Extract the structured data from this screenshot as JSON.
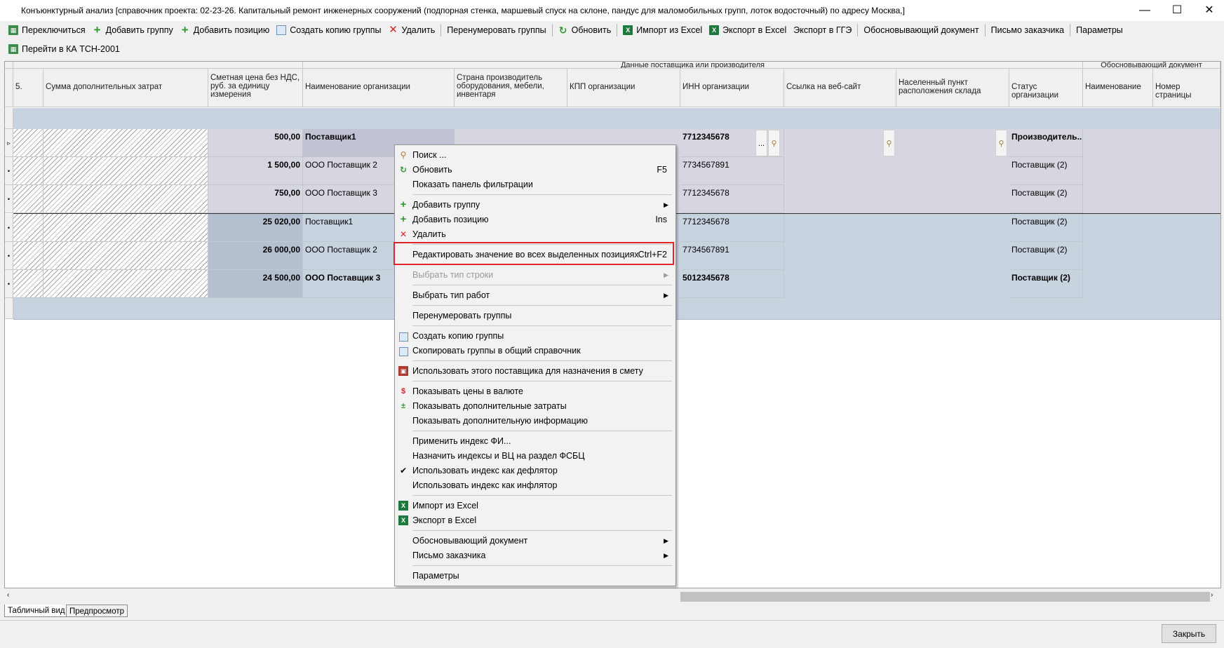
{
  "window": {
    "title": "Конъюнктурный анализ [справочник проекта: 02-23-26. Капитальный ремонт инженерных сооружений (подпорная стенка, маршевый спуск на склоне, пандус для маломобильных групп, лоток водосточный) по адресу Москва,]",
    "minimize": "—",
    "maximize": "☐",
    "close": "✕"
  },
  "toolbar1": [
    {
      "label": "Переключиться",
      "icon": "table-switch-icon"
    },
    {
      "label": "Добавить группу",
      "icon": "add-icon"
    },
    {
      "label": "Добавить позицию",
      "icon": "add-icon"
    },
    {
      "label": "Создать копию группы",
      "icon": "copy-icon"
    },
    {
      "label": "Удалить",
      "icon": "delete-icon"
    },
    {
      "label": "Перенумеровать группы",
      "icon": ""
    },
    {
      "label": "Обновить",
      "icon": "refresh-icon"
    },
    {
      "label": "Импорт из Excel",
      "icon": "excel-icon"
    },
    {
      "label": "Экспорт в Excel",
      "icon": "excel-icon"
    },
    {
      "label": "Экспорт в ГГЭ",
      "icon": ""
    },
    {
      "label": "Обосновывающий документ",
      "icon": ""
    },
    {
      "label": "Письмо заказчика",
      "icon": ""
    },
    {
      "label": "Параметры",
      "icon": ""
    }
  ],
  "toolbar2": [
    {
      "label": "Перейти в КА ТСН-2001",
      "icon": "table-switch-icon"
    }
  ],
  "grid": {
    "group_headers": {
      "supplier": "Данные поставщика или производителя",
      "doc": "Обосновывающий документ"
    },
    "columns": [
      "5.",
      "Сумма дополнительных затрат",
      "Сметная цена без НДС, руб. за единицу измерения",
      "Наименование организации",
      "Страна производитель оборудования, мебели, инвентаря",
      "КПП организации",
      "ИНН организации",
      "Ссылка на веб-сайт",
      "Населенный пункт расположения склада",
      "Статус организации",
      "Наименование",
      "Номер страницы"
    ],
    "rows": [
      {
        "price": "500,00",
        "org": "Поставщик1",
        "inn": "7712345678",
        "status": "Производитель...",
        "bold": true
      },
      {
        "price": "1 500,00",
        "org": "ООО Поставщик 2",
        "inn": "7734567891",
        "status": "Поставщик (2)",
        "bold": false
      },
      {
        "price": "750,00",
        "org": "ООО Поставщик 3",
        "inn": "7712345678",
        "status": "Поставщик (2)",
        "bold": false
      },
      {
        "price": "25 020,00",
        "org": "Поставщик1",
        "inn": "7712345678",
        "status": "Поставщик (2)",
        "bold": false
      },
      {
        "price": "26 000,00",
        "org": "ООО Поставщик 2",
        "inn": "7734567891",
        "status": "Поставщик (2)",
        "bold": false
      },
      {
        "price": "24 500,00",
        "org": "ООО Поставщик 3",
        "inn": "5012345678",
        "status": "Поставщик (2)",
        "bold": true
      }
    ],
    "ellipsis": "..."
  },
  "context_menu": {
    "items": [
      {
        "label": "Поиск ...",
        "shortcut": "",
        "icon": "search-icon"
      },
      {
        "label": "Обновить",
        "shortcut": "F5",
        "icon": "refresh-icon"
      },
      {
        "label": "Показать панель фильтрации",
        "shortcut": "",
        "icon": ""
      },
      {
        "label": "Добавить группу",
        "shortcut": "",
        "icon": "add-icon",
        "submenu": true
      },
      {
        "label": "Добавить позицию",
        "shortcut": "Ins",
        "icon": "add-icon"
      },
      {
        "label": "Удалить",
        "shortcut": "",
        "icon": "delete-icon"
      },
      {
        "label": "Редактировать значение во всех выделенных позициях",
        "shortcut": "Ctrl+F2",
        "icon": ""
      },
      {
        "label": "Выбрать тип строки",
        "shortcut": "",
        "icon": "",
        "submenu": true,
        "disabled": true
      },
      {
        "label": "Выбрать тип работ",
        "shortcut": "",
        "icon": "",
        "submenu": true
      },
      {
        "label": "Перенумеровать группы",
        "shortcut": "",
        "icon": ""
      },
      {
        "label": "Создать копию группы",
        "shortcut": "",
        "icon": "copy-icon"
      },
      {
        "label": "Скопировать группы в общий справочник",
        "shortcut": "",
        "icon": "copy-icon"
      },
      {
        "label": "Использовать этого поставщика для назначения в смету",
        "shortcut": "",
        "icon": "assign-icon"
      },
      {
        "label": "Показывать цены в валюте",
        "shortcut": "",
        "icon": "currency-icon"
      },
      {
        "label": "Показывать дополнительные затраты",
        "shortcut": "",
        "icon": "extra-costs-icon"
      },
      {
        "label": "Показывать дополнительную информацию",
        "shortcut": "",
        "icon": ""
      },
      {
        "label": "Применить индекс ФИ...",
        "shortcut": "",
        "icon": ""
      },
      {
        "label": "Назначить индексы и ВЦ на раздел ФСБЦ",
        "shortcut": "",
        "icon": ""
      },
      {
        "label": "Использовать индекс как дефлятор",
        "shortcut": "",
        "icon": "check-icon"
      },
      {
        "label": "Использовать индекс как инфлятор",
        "shortcut": "",
        "icon": ""
      },
      {
        "label": "Импорт из Excel",
        "shortcut": "",
        "icon": "excel-icon"
      },
      {
        "label": "Экспорт в Excel",
        "shortcut": "",
        "icon": "excel-icon"
      },
      {
        "label": "Обосновывающий документ",
        "shortcut": "",
        "icon": "",
        "submenu": true
      },
      {
        "label": "Письмо заказчика",
        "shortcut": "",
        "icon": "",
        "submenu": true
      },
      {
        "label": "Параметры",
        "shortcut": "",
        "icon": ""
      }
    ]
  },
  "tabs": [
    {
      "label": "Табличный вид",
      "active": true
    },
    {
      "label": "Предпросмотр",
      "active": false
    }
  ],
  "footer": {
    "close_label": "Закрыть"
  },
  "colors": {
    "selection_row": "#d6d6e0",
    "group_row": "#c8d3e0",
    "highlight_border": "#e0262a"
  }
}
